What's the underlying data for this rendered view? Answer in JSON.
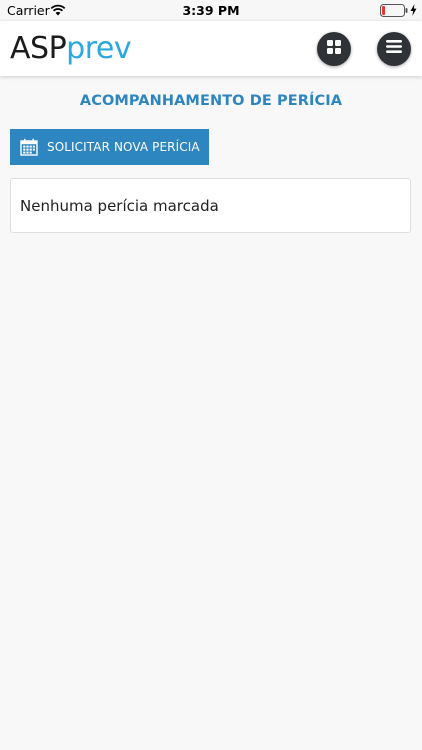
{
  "status_bar": {
    "carrier": "Carrier",
    "time": "3:39 PM",
    "battery_color": "#e53935"
  },
  "header": {
    "logo_part1": "ASP",
    "logo_part2": "prev",
    "logo_colors": {
      "asp": "#1b1b1b",
      "prev": "#2aa8df"
    },
    "grid_button_icon": "grid-icon",
    "menu_button_icon": "hamburger-icon"
  },
  "main": {
    "title": "ACOMPANHAMENTO DE PERÍCIA",
    "request_button": {
      "label": "SOLICITAR NOVA PERÍCIA",
      "icon": "calendar-icon"
    },
    "empty_message": "Nenhuma perícia marcada"
  },
  "colors": {
    "accent": "#2e86c1",
    "background": "#f8f8f8"
  }
}
